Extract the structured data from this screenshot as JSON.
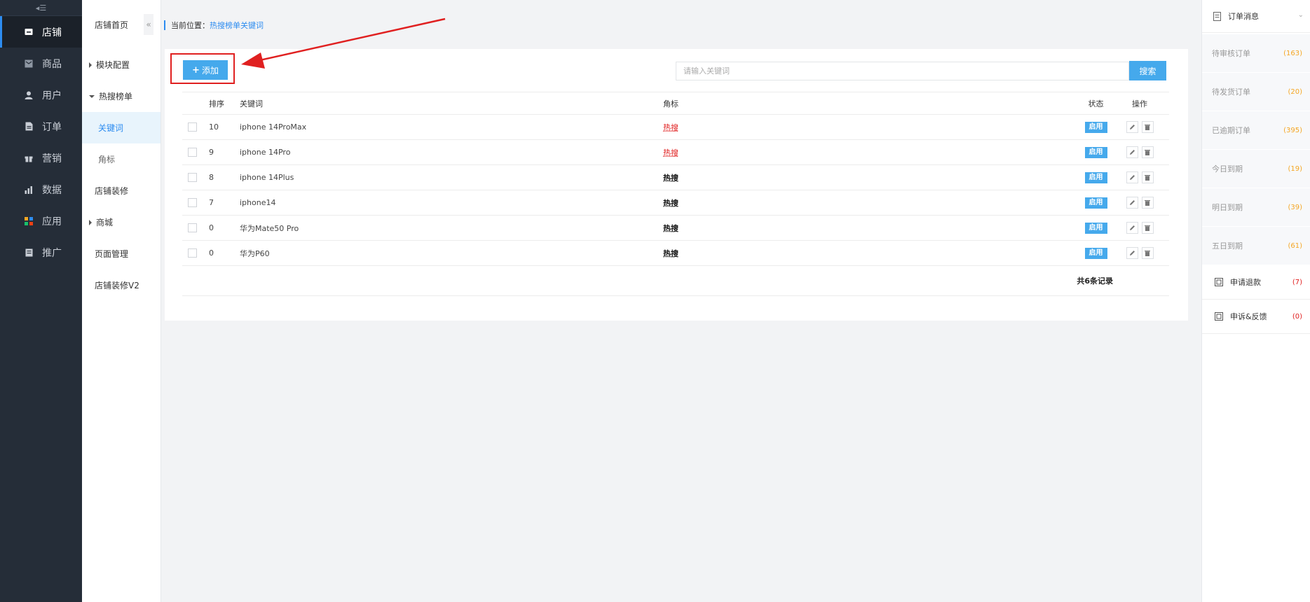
{
  "colors": {
    "accent": "#45a9ec",
    "sidebar_bg": "#252d38",
    "highlight": "#e02020",
    "warning": "#f5a623"
  },
  "nav": {
    "toggle_icon": "menu-collapse-icon",
    "items": [
      {
        "label": "店铺",
        "icon": "store-icon",
        "active": true
      },
      {
        "label": "商品",
        "icon": "goods-icon"
      },
      {
        "label": "用户",
        "icon": "user-icon"
      },
      {
        "label": "订单",
        "icon": "order-icon"
      },
      {
        "label": "营销",
        "icon": "gift-icon"
      },
      {
        "label": "数据",
        "icon": "chart-icon"
      },
      {
        "label": "应用",
        "icon": "apps-icon"
      },
      {
        "label": "推广",
        "icon": "promo-icon"
      }
    ]
  },
  "subnav": {
    "home": "店铺首页",
    "collapse": "«",
    "items": [
      {
        "label": "模块配置"
      },
      {
        "label": "热搜榜单"
      },
      {
        "label": "关键词"
      },
      {
        "label": "角标"
      },
      {
        "label": "店铺装修"
      },
      {
        "label": "商城"
      },
      {
        "label": "页面管理"
      },
      {
        "label": "店铺装修V2"
      }
    ]
  },
  "breadcrumb": {
    "prefix": "当前位置：",
    "current": "热搜榜单关键词"
  },
  "toolbar": {
    "add_label": "添加",
    "search_placeholder": "请输入关键词",
    "search_label": "搜索"
  },
  "table": {
    "headers": {
      "sort": "排序",
      "keyword": "关键词",
      "badge": "角标",
      "status": "状态",
      "ops": "操作"
    },
    "rows": [
      {
        "sort": "10",
        "keyword": "iphone 14ProMax",
        "badge": "热搜",
        "status": "启用"
      },
      {
        "sort": "9",
        "keyword": "iphone 14Pro",
        "badge": "热搜",
        "status": "启用"
      },
      {
        "sort": "8",
        "keyword": "iphone 14Plus",
        "badge": "热搜",
        "status": "启用"
      },
      {
        "sort": "7",
        "keyword": "iphone14",
        "badge": "热搜",
        "status": "启用"
      },
      {
        "sort": "0",
        "keyword": "华为Mate50 Pro",
        "badge": "热搜",
        "status": "启用"
      },
      {
        "sort": "0",
        "keyword": "华为P60",
        "badge": "热搜",
        "status": "启用"
      }
    ],
    "total": "共6条记录"
  },
  "rpanel": {
    "title": "订单消息",
    "stats": [
      {
        "label": "待审核订单",
        "count": "(163)"
      },
      {
        "label": "待发货订单",
        "count": "(20)"
      },
      {
        "label": "已逾期订单",
        "count": "(395)"
      },
      {
        "label": "今日到期",
        "count": "(19)"
      },
      {
        "label": "明日到期",
        "count": "(39)"
      },
      {
        "label": "五日到期",
        "count": "(61)"
      }
    ],
    "links": [
      {
        "label": "申请退款",
        "count": "(7)"
      },
      {
        "label": "申诉&反馈",
        "count": "(0)"
      }
    ]
  }
}
